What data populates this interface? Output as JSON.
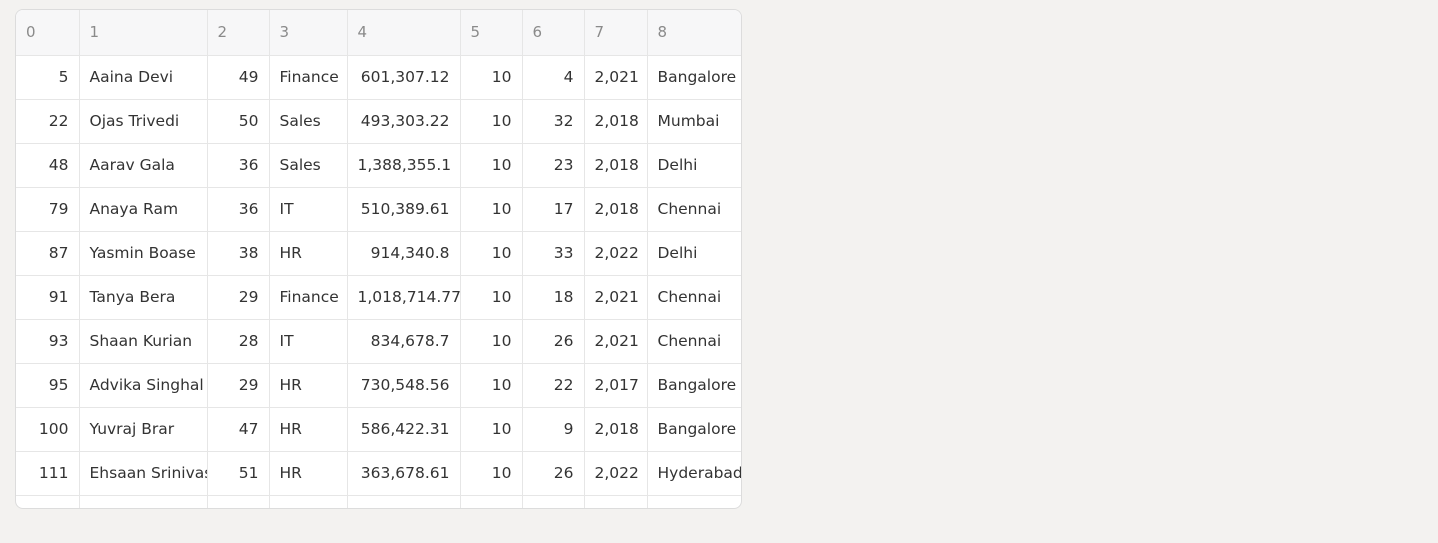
{
  "table": {
    "headers": [
      "0",
      "1",
      "2",
      "3",
      "4",
      "5",
      "6",
      "7",
      "8"
    ],
    "rows": [
      [
        "5",
        "Aaina Devi",
        "49",
        "Finance",
        "601,307.12",
        "10",
        "4",
        "2,021",
        "Bangalore"
      ],
      [
        "22",
        "Ojas Trivedi",
        "50",
        "Sales",
        "493,303.22",
        "10",
        "32",
        "2,018",
        "Mumbai"
      ],
      [
        "48",
        "Aarav Gala",
        "36",
        "Sales",
        "1,388,355.1",
        "10",
        "23",
        "2,018",
        "Delhi"
      ],
      [
        "79",
        "Anaya Ram",
        "36",
        "IT",
        "510,389.61",
        "10",
        "17",
        "2,018",
        "Chennai"
      ],
      [
        "87",
        "Yasmin Boase",
        "38",
        "HR",
        "914,340.8",
        "10",
        "33",
        "2,022",
        "Delhi"
      ],
      [
        "91",
        "Tanya Bera",
        "29",
        "Finance",
        "1,018,714.77",
        "10",
        "18",
        "2,021",
        "Chennai"
      ],
      [
        "93",
        "Shaan Kurian",
        "28",
        "IT",
        "834,678.7",
        "10",
        "26",
        "2,021",
        "Chennai"
      ],
      [
        "95",
        "Advika Singhal",
        "29",
        "HR",
        "730,548.56",
        "10",
        "22",
        "2,017",
        "Bangalore"
      ],
      [
        "100",
        "Yuvraj  Brar",
        "47",
        "HR",
        "586,422.31",
        "10",
        "9",
        "2,018",
        "Bangalore"
      ],
      [
        "111",
        "Ehsaan Srinivas",
        "51",
        "HR",
        "363,678.61",
        "10",
        "26",
        "2,022",
        "Hyderabad"
      ]
    ]
  }
}
